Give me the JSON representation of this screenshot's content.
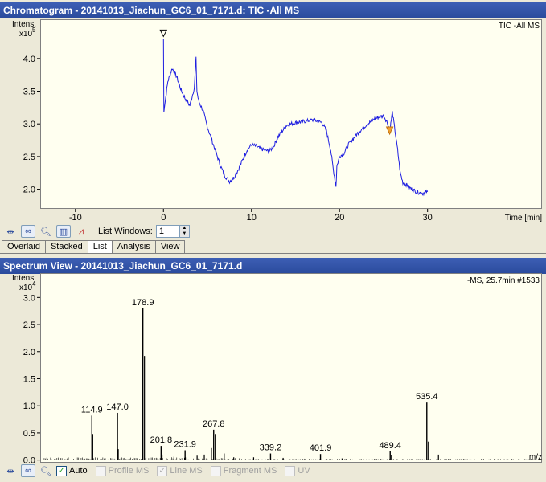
{
  "chromatogram": {
    "title": "Chromatogram - 20141013_Jiachun_GC6_01_7171.d: TIC -All MS",
    "trace_label": "TIC -All MS",
    "y_label": "Intens.",
    "y_exponent_base": "x10",
    "y_exponent": "5",
    "x_unit_label": "Time [min]",
    "line_color": "#1f1fe0"
  },
  "toolbar1": {
    "list_windows_label": "List Windows:",
    "list_windows_value": "1"
  },
  "tabs": [
    {
      "label": "Overlaid"
    },
    {
      "label": "Stacked"
    },
    {
      "label": "List"
    },
    {
      "label": "Analysis"
    },
    {
      "label": "View"
    }
  ],
  "spectrum": {
    "title": "Spectrum View - 20141013_Jiachun_GC6_01_7171.d",
    "info_label": "-MS, 25.7min #1533",
    "y_label": "Intens.",
    "y_exponent_base": "x10",
    "y_exponent": "4",
    "x_unit_label": "m/z",
    "line_color": "#000000"
  },
  "toolbar2": {
    "auto_label": "Auto",
    "auto_checked": true,
    "profile_label": "Profile MS",
    "line_label": "Line MS",
    "fragment_label": "Fragment MS",
    "uv_label": "UV"
  },
  "chart_data": [
    {
      "type": "line",
      "title": "TIC -All MS",
      "xlabel": "Time [min]",
      "ylabel": "Intens. x10^5",
      "xlim": [
        -14,
        43
      ],
      "ylim": [
        1.7,
        4.6
      ],
      "x_ticks": [
        -10,
        0,
        10,
        20,
        30
      ],
      "y_ticks": [
        2.0,
        2.5,
        3.0,
        3.5,
        4.0
      ],
      "series": [
        {
          "x": [
            0.0,
            0.05,
            0.2,
            0.5,
            1.0,
            1.5,
            2.0,
            2.5,
            3.0,
            3.5,
            3.7,
            3.8,
            4.0,
            4.5,
            5.0,
            5.5,
            6.0,
            6.5,
            7.0,
            7.5,
            8.0,
            8.5,
            9.0,
            9.5,
            10.0,
            10.5,
            11.0,
            11.5,
            12.0,
            12.5,
            13.0,
            14.0,
            15.0,
            16.0,
            17.0,
            18.0,
            18.5,
            19.0,
            19.3,
            19.6,
            19.7,
            20.0,
            20.5,
            21.0,
            22.0,
            23.0,
            24.0,
            25.0,
            25.5,
            25.7,
            26.0,
            26.3,
            26.6,
            26.9,
            27.2,
            27.5,
            28.0,
            28.5,
            29.0,
            29.5,
            30.0
          ],
          "y": [
            4.3,
            3.2,
            3.35,
            3.65,
            3.85,
            3.72,
            3.52,
            3.38,
            3.28,
            3.55,
            4.0,
            3.5,
            3.35,
            3.2,
            2.95,
            2.75,
            2.55,
            2.35,
            2.2,
            2.12,
            2.18,
            2.3,
            2.45,
            2.6,
            2.68,
            2.66,
            2.62,
            2.6,
            2.58,
            2.65,
            2.8,
            2.98,
            3.02,
            3.04,
            3.06,
            3.02,
            2.9,
            2.6,
            2.3,
            2.05,
            2.35,
            2.5,
            2.55,
            2.68,
            2.85,
            2.98,
            3.08,
            3.13,
            3.0,
            2.88,
            3.18,
            2.9,
            2.6,
            2.25,
            2.1,
            2.08,
            2.02,
            1.98,
            1.95,
            1.94,
            1.96
          ]
        }
      ],
      "annotations": [
        {
          "x": 0.0,
          "y": 4.3,
          "label": "inverted triangle marker"
        },
        {
          "x": 25.7,
          "y": 2.88,
          "label": "orange marker"
        }
      ]
    },
    {
      "type": "bar",
      "title": "-MS, 25.7min #1533",
      "xlabel": "m/z",
      "ylabel": "Intens. x10^4",
      "xlim": [
        50,
        680
      ],
      "ylim": [
        -0.05,
        3.45
      ],
      "x_ticks": [
        100,
        200,
        300,
        400,
        500,
        600
      ],
      "y_ticks": [
        0.0,
        0.5,
        1.0,
        1.5,
        2.0,
        2.5,
        3.0
      ],
      "labeled_peaks": [
        {
          "x": 114.9,
          "y": 0.82,
          "label": "114.9"
        },
        {
          "x": 147.0,
          "y": 0.87,
          "label": "147.0"
        },
        {
          "x": 178.9,
          "y": 2.8,
          "label": "178.9"
        },
        {
          "x": 201.8,
          "y": 0.26,
          "label": "201.8"
        },
        {
          "x": 231.9,
          "y": 0.18,
          "label": "231.9"
        },
        {
          "x": 267.8,
          "y": 0.56,
          "label": "267.8"
        },
        {
          "x": 339.2,
          "y": 0.12,
          "label": "339.2"
        },
        {
          "x": 401.9,
          "y": 0.11,
          "label": "401.9"
        },
        {
          "x": 489.4,
          "y": 0.16,
          "label": "489.4"
        },
        {
          "x": 535.4,
          "y": 1.06,
          "label": "535.4"
        }
      ],
      "minor_peaks": [
        {
          "x": 116,
          "y": 0.48
        },
        {
          "x": 180.9,
          "y": 1.92
        },
        {
          "x": 148,
          "y": 0.2
        },
        {
          "x": 203,
          "y": 0.1
        },
        {
          "x": 218,
          "y": 0.06
        },
        {
          "x": 247,
          "y": 0.08
        },
        {
          "x": 256,
          "y": 0.1
        },
        {
          "x": 265,
          "y": 0.22
        },
        {
          "x": 269.8,
          "y": 0.48
        },
        {
          "x": 281,
          "y": 0.12
        },
        {
          "x": 293,
          "y": 0.05
        },
        {
          "x": 318,
          "y": 0.05
        },
        {
          "x": 355,
          "y": 0.04
        },
        {
          "x": 429,
          "y": 0.03
        },
        {
          "x": 491,
          "y": 0.09
        },
        {
          "x": 537.4,
          "y": 0.34
        },
        {
          "x": 550,
          "y": 0.1
        }
      ]
    }
  ]
}
